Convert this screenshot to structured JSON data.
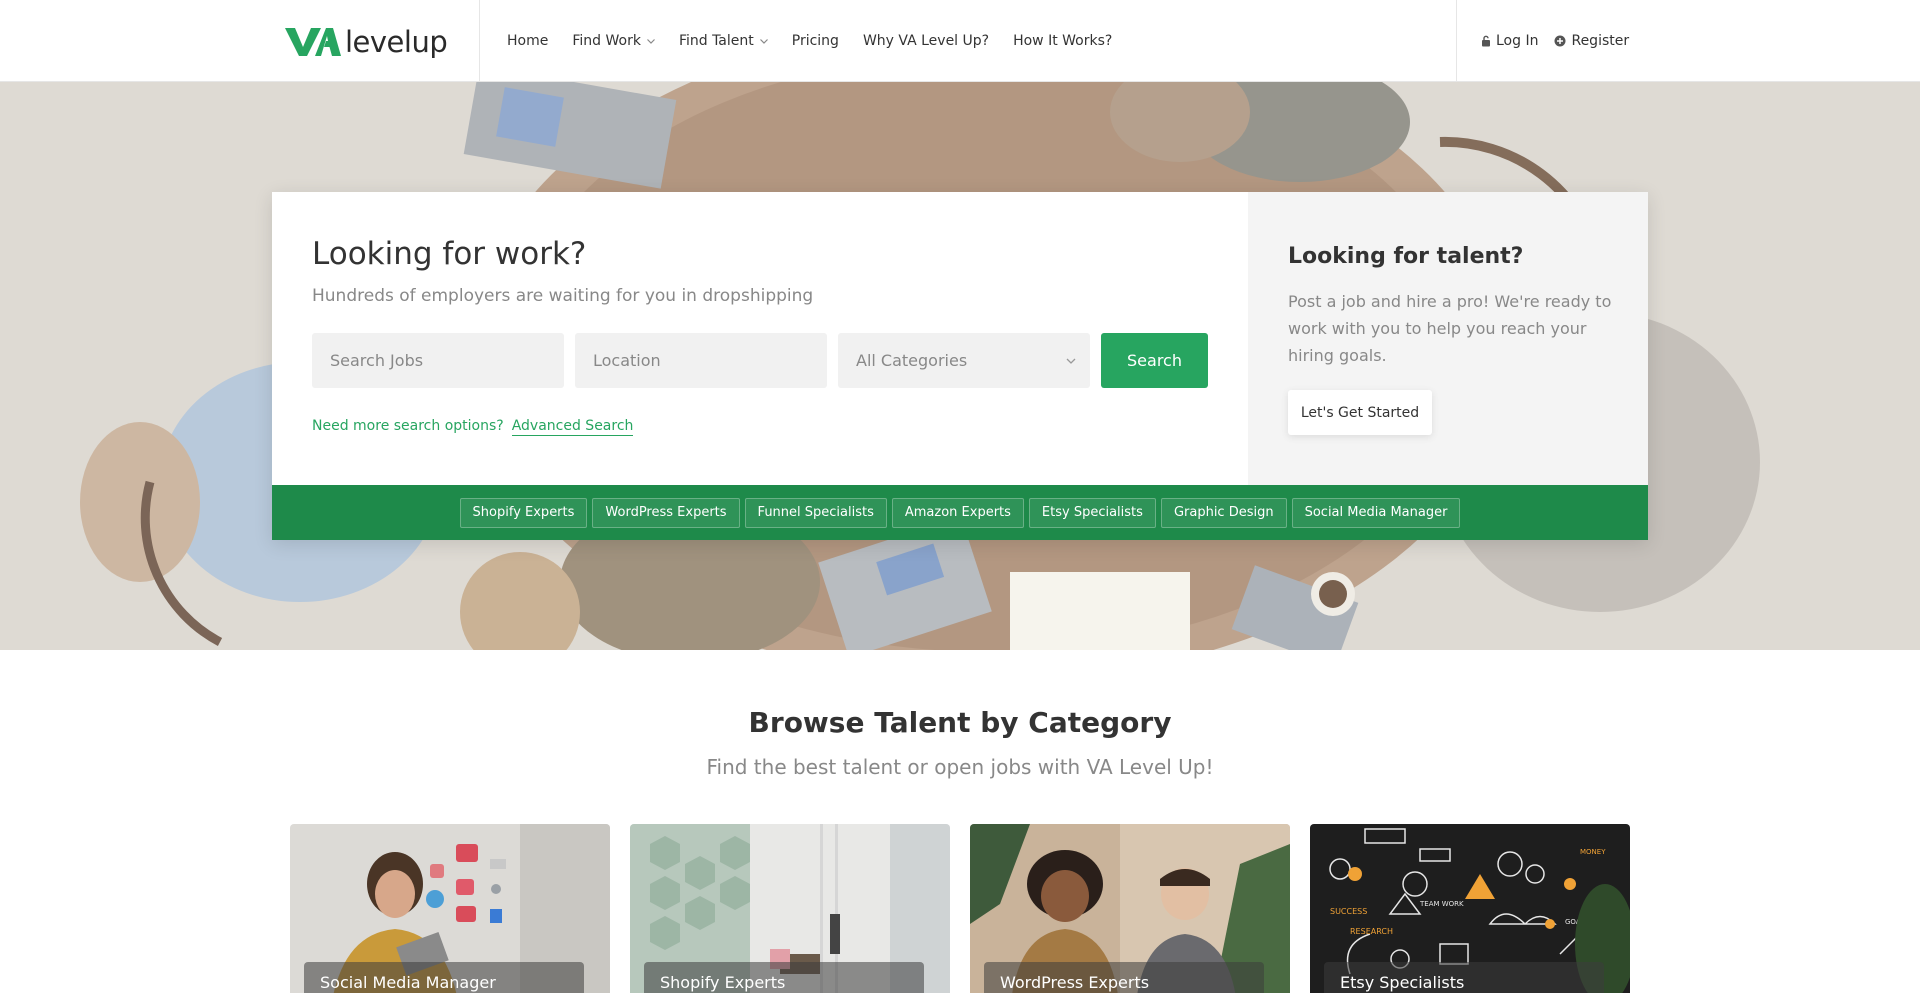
{
  "brand": {
    "name": "levelup",
    "mark": "VA",
    "primary_color": "#27a560",
    "dark_green": "#1e8a4a"
  },
  "nav": {
    "items": [
      {
        "label": "Home",
        "dropdown": false
      },
      {
        "label": "Find Work",
        "dropdown": true
      },
      {
        "label": "Find Talent",
        "dropdown": true
      },
      {
        "label": "Pricing",
        "dropdown": false
      },
      {
        "label": "Why VA Level Up?",
        "dropdown": false
      },
      {
        "label": "How It Works?",
        "dropdown": false
      }
    ],
    "login": {
      "label": "Log In",
      "icon": "lock-icon"
    },
    "register": {
      "label": "Register",
      "icon": "plus-circle-icon"
    }
  },
  "hero": {
    "work": {
      "title": "Looking for work?",
      "subtitle": "Hundreds of employers are waiting for you in dropshipping",
      "search_jobs_placeholder": "Search Jobs",
      "location_placeholder": "Location",
      "category_selected": "All Categories",
      "search_button": "Search",
      "more_options_text": "Need more search options?",
      "advanced_search_link": "Advanced Search"
    },
    "talent": {
      "title": "Looking for talent?",
      "description": "Post a job and hire a pro! We're ready to work with you to help you reach your hiring goals.",
      "cta": "Let's Get Started"
    },
    "tags": [
      "Shopify Experts",
      "WordPress Experts",
      "Funnel Specialists",
      "Amazon Experts",
      "Etsy Specialists",
      "Graphic Design",
      "Social Media Manager"
    ]
  },
  "browse": {
    "title": "Browse Talent by Category",
    "subtitle": "Find the best talent or open jobs with VA Level Up!",
    "categories": [
      {
        "label": "Social Media Manager"
      },
      {
        "label": "Shopify Experts"
      },
      {
        "label": "WordPress Experts"
      },
      {
        "label": "Etsy Specialists"
      }
    ]
  }
}
